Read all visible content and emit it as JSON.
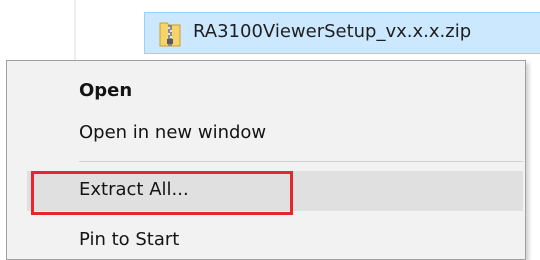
{
  "file": {
    "name": "RA3100ViewerSetup_vx.x.x.zip",
    "icon": "zip-folder-icon"
  },
  "context_menu": {
    "items": [
      {
        "label": "Open",
        "default": true
      },
      {
        "label": "Open in new window"
      },
      {
        "label": "Extract All..."
      },
      {
        "label": "Pin to Start"
      }
    ]
  },
  "colors": {
    "selection_fill": "#cce8ff",
    "selection_border": "#99d1ff",
    "menu_background": "#f2f2f2",
    "hover_fill": "#e0e0e0",
    "annotation_red": "#e8252e"
  }
}
